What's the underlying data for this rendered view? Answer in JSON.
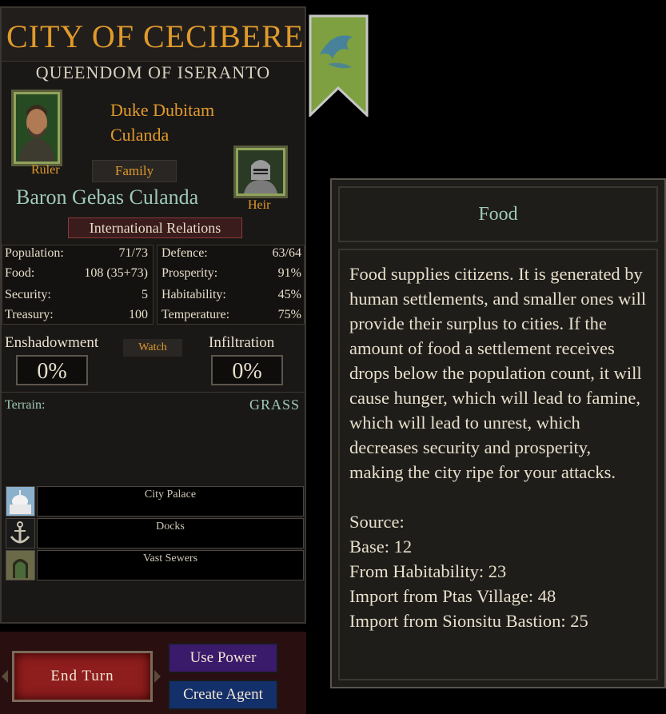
{
  "city_panel": {
    "title": "CITY OF CECIBERE",
    "kingdom": "QUEENDOM OF ISERANTO",
    "ruler_name_line1": "Duke Dubitam",
    "ruler_name_line2": "Culanda",
    "ruler_label": "Ruler",
    "family_button": "Family",
    "heir_name": "Baron Gebas Culanda",
    "heir_label": "Heir",
    "relations_button": "International Relations"
  },
  "stats": {
    "left": [
      {
        "label": "Population:",
        "value": "71/73"
      },
      {
        "label": "Food:",
        "value": "108 (35+73)"
      },
      {
        "label": "Security:",
        "value": "5"
      },
      {
        "label": "Treasury:",
        "value": "100"
      }
    ],
    "right": [
      {
        "label": "Defence:",
        "value": "63/64"
      },
      {
        "label": "Prosperity:",
        "value": "91%"
      },
      {
        "label": "Habitability:",
        "value": "45%"
      },
      {
        "label": "Temperature:",
        "value": "75%"
      }
    ]
  },
  "espionage": {
    "enshadowment_label": "Enshadowment",
    "watch_button": "Watch",
    "infiltration_label": "Infiltration",
    "enshadowment_value": "0%",
    "infiltration_value": "0%"
  },
  "terrain": {
    "label": "Terrain:",
    "value": "GRASS"
  },
  "buildings": [
    {
      "name": "City Palace",
      "icon": "palace-icon"
    },
    {
      "name": "Docks",
      "icon": "anchor-icon"
    },
    {
      "name": "Vast Sewers",
      "icon": "sewer-icon"
    }
  ],
  "bottom_bar": {
    "end_turn": "End Turn",
    "use_power": "Use Power",
    "create_agent": "Create Agent"
  },
  "tooltip": {
    "title": "Food",
    "description": "Food supplies citizens. It is generated by human settlements, and smaller ones will provide their surplus to cities. If the amount of food a settlement receives drops below the population count, it will cause hunger, which will lead to famine, which will lead to unrest, which decreases security and prosperity, making the city ripe for your attacks.",
    "source_label": "Source:",
    "sources": [
      "Base: 12",
      "From Habitability: 23",
      "Import from Ptas Village: 48",
      "Import from Sionsitu Bastion: 25"
    ]
  },
  "colors": {
    "title_gold": "#e09a2c",
    "heir_teal": "#9ec9b8",
    "end_turn_red": "#8e1d1d",
    "use_power_purple": "#3a1a6a",
    "create_agent_blue": "#14306a",
    "banner_green": "#7ea040"
  }
}
